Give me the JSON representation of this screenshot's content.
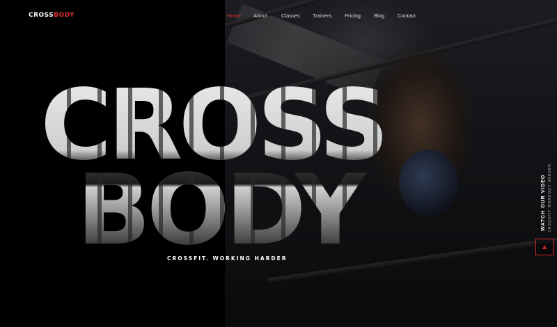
{
  "logo": {
    "part1": "CROSS",
    "part2": "BODY"
  },
  "nav": {
    "items": [
      {
        "label": "Home",
        "active": true
      },
      {
        "label": "About",
        "active": false
      },
      {
        "label": "Classes",
        "active": false
      },
      {
        "label": "Trainers",
        "active": false
      },
      {
        "label": "Pricing",
        "active": false
      },
      {
        "label": "Blog",
        "active": false
      },
      {
        "label": "Contact",
        "active": false
      }
    ]
  },
  "hero": {
    "line1": "CROSS",
    "line2": "BODY",
    "tagline": "CROSSFIT. WORKING HARDER"
  },
  "video": {
    "watch_label": "WATCH OUR VIDEO",
    "sub_label": "CROSSFIT WORKOUT HARDER",
    "play_icon": "play-icon"
  },
  "colors": {
    "accent": "#e03131",
    "background": "#000000"
  }
}
